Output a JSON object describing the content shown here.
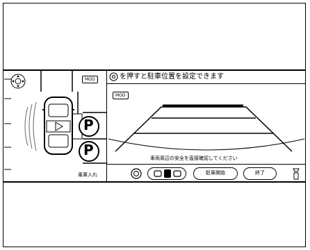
{
  "header": {
    "instruction": "を押すと駐車位置を設定できます"
  },
  "badges": {
    "mod_left": "MOD",
    "mod_right": "MOD"
  },
  "camera": {
    "caution": "車両周辺の安全を直接確認してください"
  },
  "left_panel": {
    "mode_label": "車庫入れ",
    "parking_symbol": "P"
  },
  "toolbar": {
    "start_label": "駐車開始",
    "end_label": "終了"
  },
  "icons": {
    "view_switch": "camera-view-icon",
    "parking_assist": "parking-assist-icon",
    "settings": "settings-icon"
  }
}
